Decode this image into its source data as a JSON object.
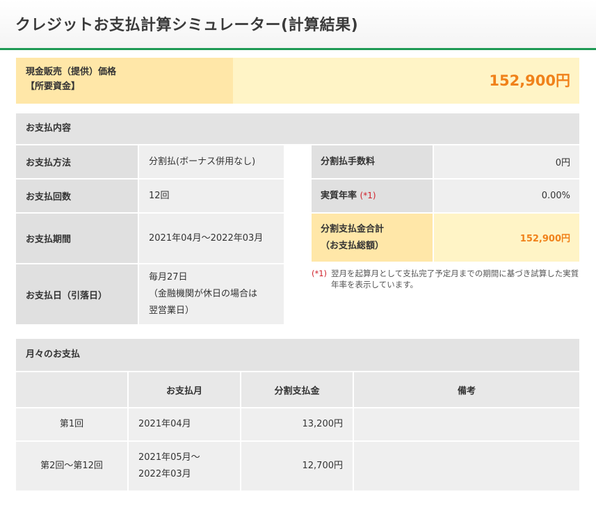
{
  "page_title": "クレジットお支払計算シミュレーター(計算結果)",
  "price": {
    "label_line1": "現金販売（提供）価格",
    "label_line2": "【所要資金】",
    "value": "152,900円"
  },
  "payment_details": {
    "heading": "お支払内容",
    "left_rows": [
      {
        "label": "お支払方法",
        "value": "分割払(ボーナス併用なし)"
      },
      {
        "label": "お支払回数",
        "value": "12回"
      },
      {
        "label": "お支払期間",
        "value": "2021年04月～2022年03月"
      },
      {
        "label": "お支払日（引落日）",
        "value_line1": "毎月27日",
        "value_line2": "（金融機関が休日の場合は",
        "value_line3": "翌営業日）"
      }
    ],
    "right_rows": [
      {
        "label": "分割払手数料",
        "value": "0円"
      },
      {
        "label": "実質年率",
        "label_mark": "(*1)",
        "value": "0.00%"
      },
      {
        "label_line1": "分割支払金合計",
        "label_line2": "（お支払総額）",
        "value": "152,900円"
      }
    ],
    "note_mark": "(*1)",
    "note_text": "翌月を起算月として支払完了予定月までの期間に基づき試算した実質年率を表示しています。"
  },
  "monthly": {
    "heading": "月々のお支払",
    "columns": [
      "",
      "お支払月",
      "分割支払金",
      "備考"
    ],
    "rows": [
      {
        "no": "第1回",
        "month": "2021年04月",
        "amount": "13,200円",
        "remark": ""
      },
      {
        "no": "第2回～第12回",
        "month_line1": "2021年05月～",
        "month_line2": "2022年03月",
        "amount": "12,700円",
        "remark": ""
      }
    ]
  },
  "colors": {
    "accent_green": "#1e9a54",
    "price_orange": "#f0811a",
    "highlight_yellow": "#fff4c6",
    "note_red": "#d0202a"
  }
}
